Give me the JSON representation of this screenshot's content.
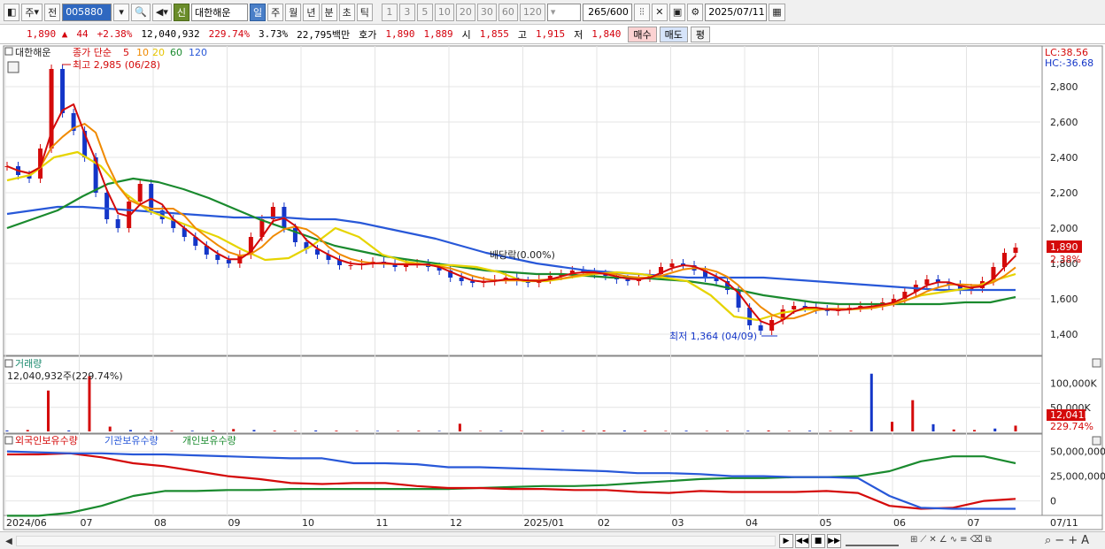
{
  "toolbar": {
    "period_type": "주",
    "prev_label": "전",
    "stock_code": "005880",
    "stock_name": "대한해운",
    "sin_label": "신",
    "period_buttons": [
      "일",
      "주",
      "월",
      "년",
      "분",
      "초",
      "틱"
    ],
    "selected_period": "일",
    "interval_buttons": [
      "1",
      "3",
      "5",
      "10",
      "20",
      "30",
      "60",
      "120"
    ],
    "bar_count": "265",
    "bar_total": "/600",
    "date": "2025/07/11"
  },
  "quote": {
    "price": "1,890",
    "change": "44",
    "change_pct": "+2.38%",
    "volume": "12,040,932",
    "volume_ratio": "229.74%",
    "turnover": "3.73%",
    "amount": "22,795백만",
    "ask_label": "호가",
    "ask": "1,890",
    "bid": "1,889",
    "open_label": "시",
    "open": "1,855",
    "high_label": "고",
    "high": "1,915",
    "low_label": "저",
    "low": "1,840",
    "buy_label": "매수",
    "sell_label": "매도",
    "eval_label": "평"
  },
  "price_panel": {
    "stock_label": "대한해운",
    "ma_label": "종가 단순",
    "ma_periods": [
      "5",
      "10",
      "20",
      "60",
      "120"
    ],
    "ma_colors": [
      "#d40a0a",
      "#f08a00",
      "#e6d400",
      "#1a8a2e",
      "#2858d8"
    ],
    "lc": "LC:38.56",
    "hc": "HC:-36.68",
    "high_marker": "최고 2,985 (06/28)",
    "low_marker": "최저 1,364 (04/09)",
    "dividend_marker": "배당락(0.00%)",
    "current_price_tag": "1,890",
    "current_pct_tag": "2.38%",
    "yaxis_ticks": [
      "2,800",
      "2,600",
      "2,400",
      "2,200",
      "2,000",
      "1,800",
      "1,600",
      "1,400"
    ]
  },
  "volume_panel": {
    "title": "거래량",
    "value_label": "12,040,932주(229.74%)",
    "yaxis_ticks": [
      "100,000K",
      "50,000K"
    ],
    "current_tag": "12,041K",
    "current_pct_tag": "229.74%"
  },
  "holding_panel": {
    "series_labels": [
      "외국인보유수량",
      "기관보유수량",
      "개인보유수량"
    ],
    "series_colors": [
      "#d40a0a",
      "#2858d8",
      "#1a8a2e"
    ],
    "yaxis_ticks": [
      "50,000,000",
      "25,000,000",
      "0"
    ]
  },
  "xaxis_labels": [
    "2024/06",
    "07",
    "08",
    "09",
    "10",
    "11",
    "12",
    "2025/01",
    "02",
    "03",
    "04",
    "05",
    "06",
    "07"
  ],
  "xaxis_right_label": "07/11",
  "chart_data": {
    "type": "line",
    "ylim": [
      1300,
      3000
    ],
    "months": [
      "2024/06",
      "07",
      "08",
      "09",
      "10",
      "11",
      "12",
      "2025/01",
      "02",
      "03",
      "04",
      "05",
      "06",
      "07"
    ],
    "close_series": [
      2350,
      2300,
      2280,
      2450,
      2900,
      2650,
      2550,
      2400,
      2200,
      2050,
      2000,
      2150,
      2250,
      2100,
      2050,
      2000,
      1950,
      1900,
      1850,
      1820,
      1800,
      1850,
      1950,
      2050,
      2120,
      2000,
      1920,
      1880,
      1850,
      1820,
      1790,
      1790,
      1800,
      1810,
      1800,
      1780,
      1800,
      1800,
      1780,
      1760,
      1720,
      1700,
      1690,
      1700,
      1710,
      1720,
      1700,
      1690,
      1710,
      1730,
      1740,
      1760,
      1750,
      1740,
      1730,
      1710,
      1700,
      1720,
      1740,
      1780,
      1800,
      1790,
      1760,
      1720,
      1700,
      1650,
      1550,
      1450,
      1420,
      1480,
      1540,
      1560,
      1550,
      1540,
      1530,
      1540,
      1550,
      1560,
      1560,
      1580,
      1600,
      1640,
      1680,
      1710,
      1690,
      1680,
      1650,
      1660,
      1700,
      1780,
      1860,
      1890
    ],
    "ma120": [
      2080,
      2100,
      2120,
      2120,
      2110,
      2100,
      2090,
      2080,
      2070,
      2060,
      2060,
      2060,
      2050,
      2050,
      2030,
      2000,
      1970,
      1940,
      1900,
      1860,
      1830,
      1800,
      1780,
      1760,
      1750,
      1740,
      1730,
      1720,
      1720,
      1720,
      1720,
      1710,
      1700,
      1690,
      1680,
      1670,
      1660,
      1650,
      1650,
      1650,
      1650
    ],
    "ma60": [
      2000,
      2050,
      2100,
      2180,
      2250,
      2280,
      2260,
      2220,
      2170,
      2110,
      2050,
      2000,
      1950,
      1900,
      1870,
      1840,
      1820,
      1800,
      1780,
      1760,
      1750,
      1740,
      1740,
      1730,
      1720,
      1720,
      1710,
      1700,
      1680,
      1650,
      1620,
      1600,
      1580,
      1570,
      1570,
      1570,
      1570,
      1570,
      1580,
      1580,
      1610
    ],
    "ma20": [
      2270,
      2300,
      2400,
      2430,
      2350,
      2200,
      2100,
      2050,
      2000,
      1950,
      1880,
      1820,
      1830,
      1900,
      2000,
      1950,
      1850,
      1810,
      1790,
      1790,
      1780,
      1750,
      1700,
      1700,
      1720,
      1740,
      1750,
      1740,
      1720,
      1700,
      1620,
      1500,
      1480,
      1520,
      1540,
      1540,
      1540,
      1550,
      1580,
      1620,
      1640,
      1660,
      1700,
      1740
    ],
    "volume_k": [
      2000,
      3000,
      85000,
      2000,
      115000,
      10000,
      3000,
      2000,
      1500,
      1500,
      2000,
      5000,
      3000,
      1500,
      1000,
      2000,
      1500,
      1000,
      1200,
      1000,
      1500,
      1000,
      16000,
      1000,
      1200,
      1000,
      1500,
      1000,
      1500,
      2000,
      2000,
      1500,
      1000,
      1500,
      1000,
      1200,
      1500,
      2000,
      1000,
      1500,
      1000,
      1500,
      120000,
      20000,
      65000,
      15000,
      4000,
      3000,
      6000,
      12041
    ],
    "foreign_holding": [
      47000000,
      47000000,
      48000000,
      44000000,
      38000000,
      35000000,
      30000000,
      25000000,
      22000000,
      18000000,
      17000000,
      18000000,
      18000000,
      15000000,
      13000000,
      13000000,
      12000000,
      12000000,
      11000000,
      11000000,
      9000000,
      8000000,
      10000000,
      9000000,
      9000000,
      9000000,
      10000000,
      8000000,
      -5000000,
      -8000000,
      -7000000,
      0,
      2000000
    ],
    "institution_holding": [
      50000000,
      49000000,
      48000000,
      48000000,
      47000000,
      47000000,
      46000000,
      45000000,
      44000000,
      43000000,
      43000000,
      38000000,
      38000000,
      37000000,
      34000000,
      34000000,
      33000000,
      32000000,
      31000000,
      30000000,
      28000000,
      28000000,
      27000000,
      25000000,
      25000000,
      24000000,
      24000000,
      23000000,
      5000000,
      -7000000,
      -8000000,
      -8000000,
      -8000000
    ],
    "individual_holding": [
      -15000000,
      -15000000,
      -12000000,
      -5000000,
      5000000,
      10000000,
      10000000,
      11000000,
      11000000,
      12000000,
      12000000,
      12000000,
      12000000,
      12000000,
      12000000,
      13000000,
      14000000,
      15000000,
      15000000,
      16000000,
      18000000,
      20000000,
      22000000,
      23000000,
      23000000,
      24000000,
      24000000,
      25000000,
      30000000,
      40000000,
      45000000,
      45000000,
      38000000
    ]
  }
}
